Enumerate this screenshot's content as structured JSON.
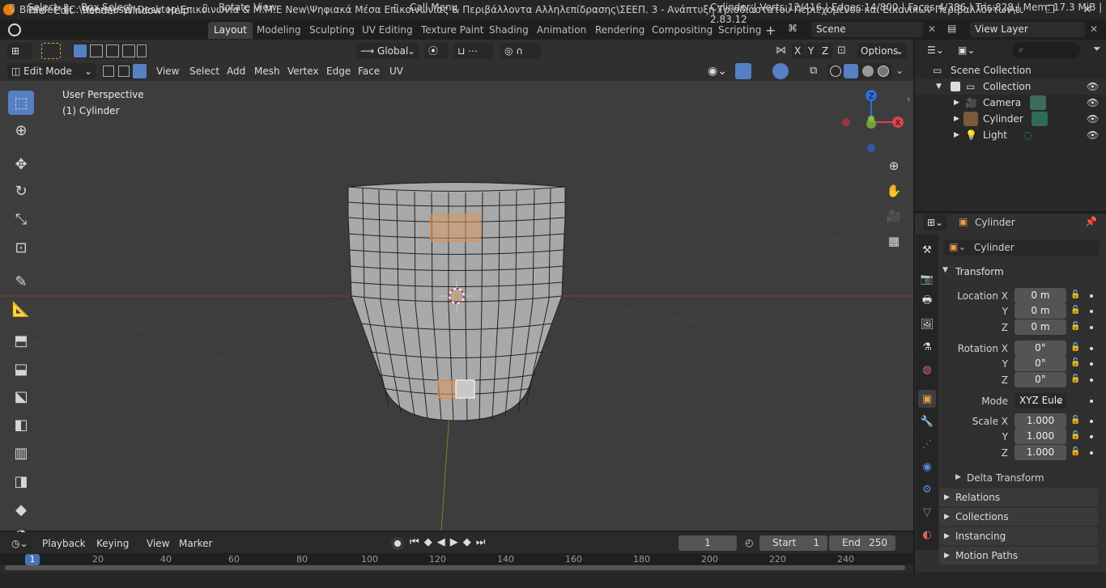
{
  "title_bar": {
    "title": "Blender* [C:\\Users\\user\\Desktop\\Επικοινωνία & Μ.Μ.Ε New\\Ψηφιακά Μέσα Επικοινωνίας & Περιβάλλοντα Αλληλεπίδρασης\\ΣΕΕΠ. 3 - Ανάπτυξη Τρισδιάστατου Περιεχομένου και Εικονικών Περιβαλλόντων\\tutorial.blend]",
    "minimize": "—",
    "maximize": "❐",
    "close": "✕"
  },
  "menu": {
    "file": "File",
    "edit": "Edit",
    "render": "Render",
    "window": "Window",
    "help": "Help"
  },
  "workspaces": [
    {
      "label": "Layout",
      "active": true
    },
    {
      "label": "Modeling"
    },
    {
      "label": "Sculpting"
    },
    {
      "label": "UV Editing"
    },
    {
      "label": "Texture Paint"
    },
    {
      "label": "Shading"
    },
    {
      "label": "Animation"
    },
    {
      "label": "Rendering"
    },
    {
      "label": "Compositing"
    },
    {
      "label": "Scripting"
    }
  ],
  "scene": {
    "label": "Scene"
  },
  "view_layer": {
    "label": "View Layer"
  },
  "header": {
    "transform_orientation": "Global",
    "options": "Options",
    "mode": "Edit Mode",
    "menus": [
      "View",
      "Select",
      "Add",
      "Mesh",
      "Vertex",
      "Edge",
      "Face",
      "UV"
    ],
    "x": "X",
    "y": "Y",
    "z": "Z"
  },
  "viewport": {
    "perspective": "User Perspective",
    "object": "(1) Cylinder"
  },
  "gizmo": {
    "x": "X",
    "y": "Y",
    "z": "Z"
  },
  "timeline": {
    "menus": [
      "Playback",
      "Keying",
      "View",
      "Marker"
    ],
    "current_frame": "1",
    "start_label": "Start",
    "start_value": "1",
    "end_label": "End",
    "end_value": "250",
    "ruler": [
      "1",
      "20",
      "40",
      "60",
      "80",
      "100",
      "120",
      "140",
      "160",
      "180",
      "200",
      "220",
      "240"
    ]
  },
  "status": {
    "select": "Select",
    "box_select": "Box Select",
    "rotate_view": "Rotate View",
    "call_menu": "Call Menu",
    "stats": "Cylinder | Verts:12/416 | Edges:14/800 | Faces:4/386 | Tris:828 | Mem: 17.3 MiB | 2.83.12"
  },
  "outliner": {
    "root": "Scene Collection",
    "items": [
      {
        "label": "Collection"
      },
      {
        "label": "Camera"
      },
      {
        "label": "Cylinder"
      },
      {
        "label": "Light"
      }
    ]
  },
  "properties": {
    "object_name": "Cylinder",
    "datablock": "Cylinder",
    "transform_label": "Transform",
    "location_label": "Location X",
    "rotation_label": "Rotation X",
    "scale_label": "Scale X",
    "y": "Y",
    "z": "Z",
    "location": [
      "0 m",
      "0 m",
      "0 m"
    ],
    "rotation": [
      "0°",
      "0°",
      "0°"
    ],
    "mode_label": "Mode",
    "mode_value": "XYZ Eule",
    "scale": [
      "1.000",
      "1.000",
      "1.000"
    ],
    "delta_transform": "Delta Transform",
    "sections": [
      "Relations",
      "Collections",
      "Instancing",
      "Motion Paths"
    ]
  }
}
